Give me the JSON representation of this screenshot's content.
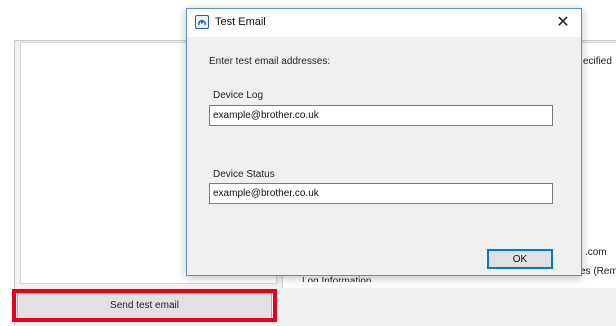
{
  "dialog": {
    "title": "Test Email",
    "close_glyph": "✕",
    "prompt": "Enter test email addresses:",
    "fields": [
      {
        "label": "Device Log",
        "value": "example@brother.co.uk"
      },
      {
        "label": "Device Status",
        "value": "example@brother.co.uk"
      }
    ],
    "ok_label": "OK"
  },
  "background": {
    "send_button_label": "Send test email",
    "right_snippets": [
      "ecified",
      ".com",
      "es (Rem",
      "Log Information"
    ]
  },
  "colors": {
    "highlight": "#e3001b",
    "dialog_border": "#5c8fc8",
    "ok_focus": "#0078d7"
  }
}
